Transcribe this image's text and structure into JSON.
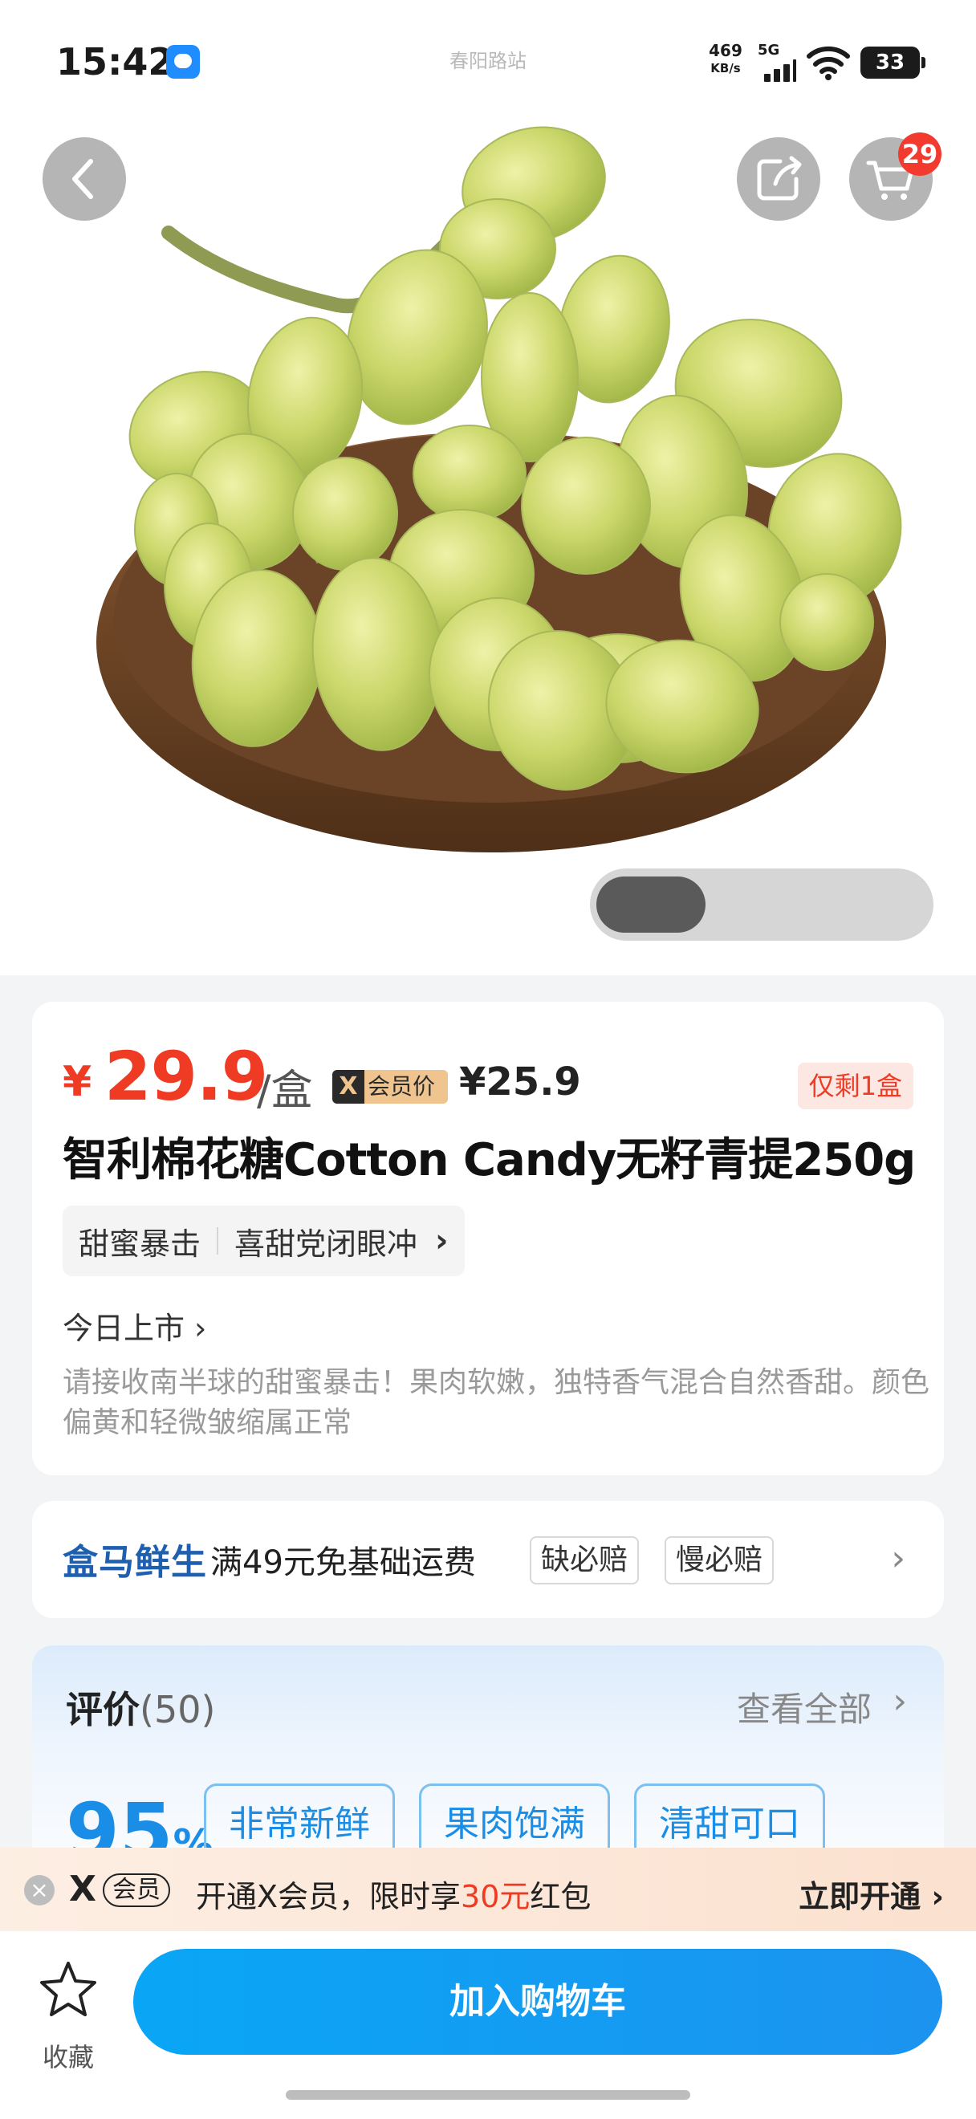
{
  "status_bar": {
    "time": "15:42",
    "station": "春阳路站",
    "net_speed": "469",
    "net_unit": "KB/s",
    "network": "5G",
    "battery": "33"
  },
  "header": {
    "cart_badge": "29",
    "icons": [
      "back-arrow-icon",
      "share-icon",
      "cart-icon"
    ]
  },
  "product": {
    "currency": "¥",
    "price": "29.9",
    "unit": "/盒",
    "vip_brand": "X",
    "vip_label": "会员价",
    "vip_price": "¥25.9",
    "stock": "仅剩1盒",
    "title": "智利棉花糖Cotton Candy无籽青提250g",
    "tags": [
      "甜蜜暴击",
      "喜甜党闭眼冲"
    ],
    "launch": "今日上市",
    "description": "请接收南半球的甜蜜暴击！果肉软嫩，独特香气混合自然香甜。颜色偏黄和轻微皱缩属正常"
  },
  "shipping": {
    "brand": "盒马鲜生",
    "text": "满49元免基础运费",
    "tags": [
      "缺必赔",
      "慢必赔"
    ]
  },
  "reviews": {
    "title": "评价",
    "count": "(50)",
    "view_all": "查看全部",
    "score": "95",
    "score_unit": "%",
    "tags": [
      "非常新鲜",
      "果肉饱满",
      "清甜可口"
    ]
  },
  "vip_banner": {
    "logo": "X",
    "logo_tag": "会员",
    "text_prefix": "开通X会员，限时享",
    "amount": "30元",
    "text_suffix": "红包",
    "cta": "立即开通 ›"
  },
  "bottom_bar": {
    "favorite_label": "收藏",
    "add_to_cart": "加入购物车"
  },
  "colors": {
    "price": "#ef3b24",
    "accent_blue": "#1c93ef",
    "brand_blue": "#1f5fb0"
  }
}
